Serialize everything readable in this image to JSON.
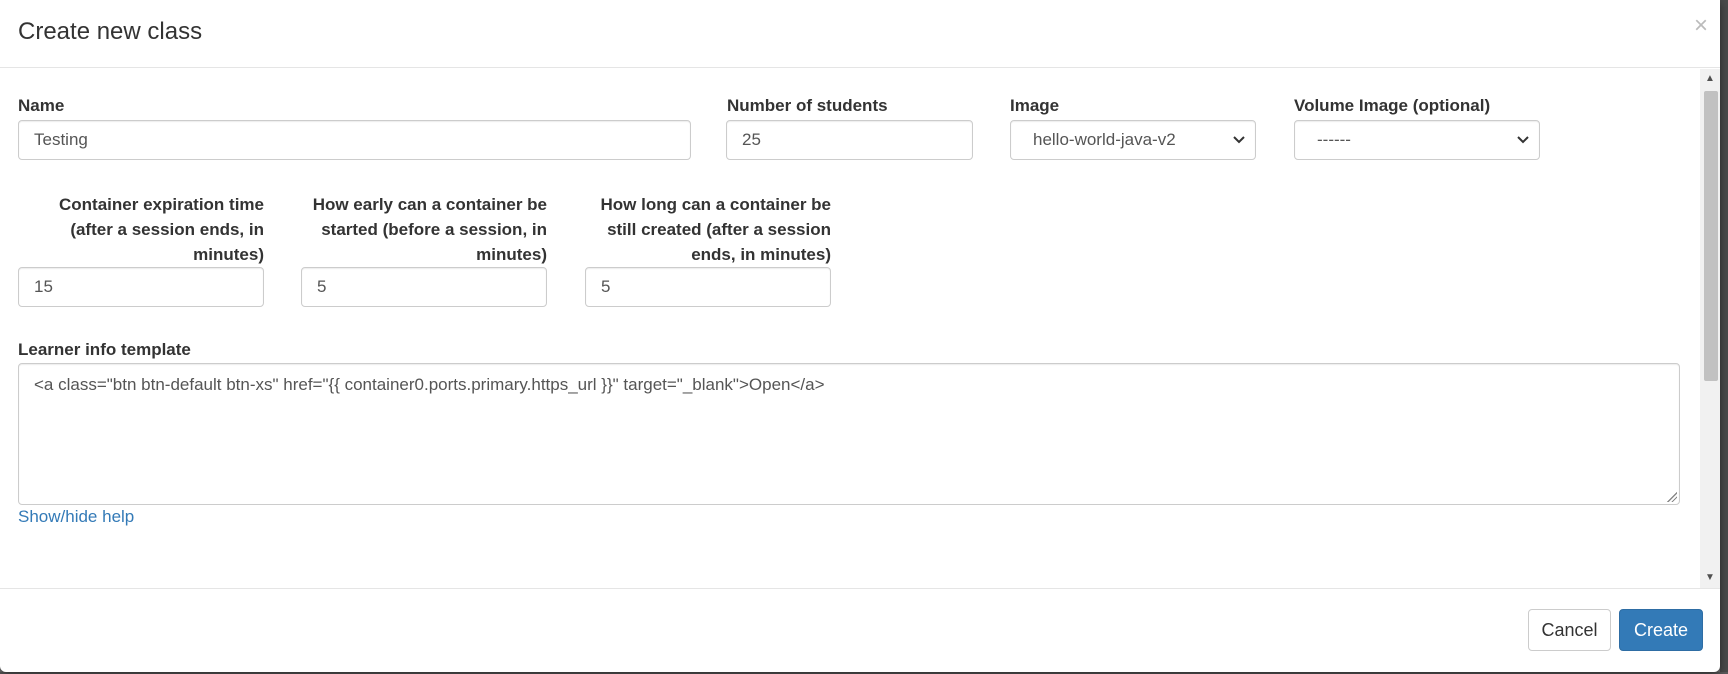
{
  "modal": {
    "title": "Create new class",
    "close_glyph": "×"
  },
  "form": {
    "name": {
      "label": "Name",
      "value": "Testing"
    },
    "num_students": {
      "label": "Number of students",
      "value": "25"
    },
    "image": {
      "label": "Image",
      "selected": "hello-world-java-v2"
    },
    "volume_image": {
      "label": "Volume Image (optional)",
      "selected": "------"
    },
    "expiration": {
      "label_lines": [
        "Container expiration time",
        "(after a session ends, in",
        "minutes)"
      ],
      "value": "15"
    },
    "early_start": {
      "label_lines": [
        "How early can a container be",
        "started (before a session, in",
        "minutes)"
      ],
      "value": "5"
    },
    "late_create": {
      "label_lines": [
        "How long can a container be",
        "still created (after a session",
        "ends, in minutes)"
      ],
      "value": "5"
    },
    "learner_template": {
      "label": "Learner info template",
      "value": "<a class=\"btn btn-default btn-xs\" href=\"{{ container0.ports.primary.https_url }}\" target=\"_blank\">Open</a>"
    },
    "help_link": "Show/hide help"
  },
  "footer": {
    "cancel_label": "Cancel",
    "create_label": "Create"
  },
  "colors": {
    "primary": "#337ab7",
    "link": "#337ab7",
    "border": "#cccccc"
  },
  "icons": {
    "close": "close-icon",
    "select_chevron": "chevron-down-icon",
    "scroll_up": "scroll-up-arrow-icon",
    "scroll_down": "scroll-down-arrow-icon"
  }
}
